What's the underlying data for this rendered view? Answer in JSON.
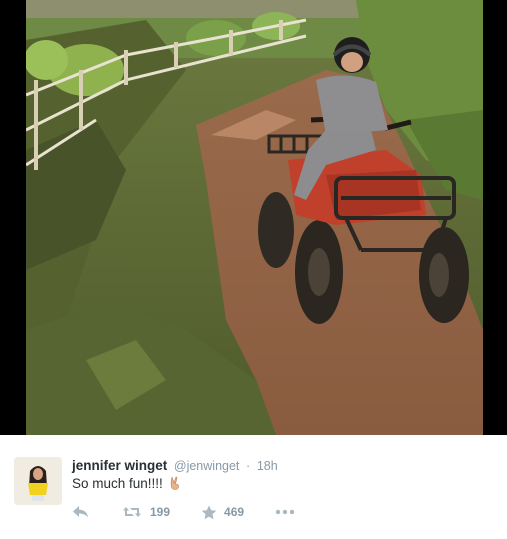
{
  "tweet": {
    "author_name": "jennifer winget",
    "handle": "@jenwinget",
    "separator": "·",
    "time": "18h",
    "text": "So much fun!!!!"
  },
  "actions": {
    "reply_icon": "reply-icon",
    "retweet_icon": "retweet-icon",
    "retweet_count": "199",
    "favorite_icon": "star-icon",
    "favorite_count": "469",
    "more_icon": "more-dots-icon"
  },
  "colors": {
    "muted": "#8899a6",
    "text": "#292f33"
  }
}
